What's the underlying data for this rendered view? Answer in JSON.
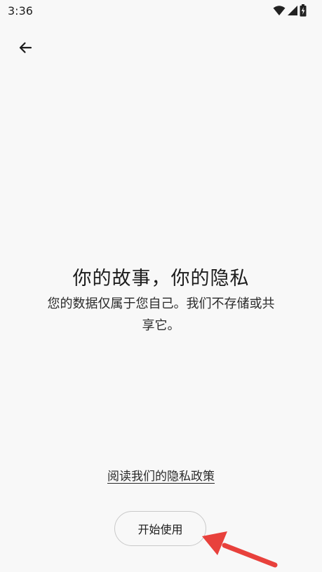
{
  "status_bar": {
    "time": "3:36",
    "icons": [
      "wifi-icon",
      "cellular-signal-icon",
      "battery-charging-icon"
    ]
  },
  "nav": {
    "back_icon": "back-arrow-icon"
  },
  "main": {
    "headline": "你的故事，你的隐私",
    "description": "您的数据仅属于您自己。我们不存储或共享它。"
  },
  "footer": {
    "privacy_link": "阅读我们的隐私政策",
    "start_button": "开始使用"
  },
  "colors": {
    "background": "#f8f8f8",
    "annotation_arrow": "#e8413c"
  }
}
